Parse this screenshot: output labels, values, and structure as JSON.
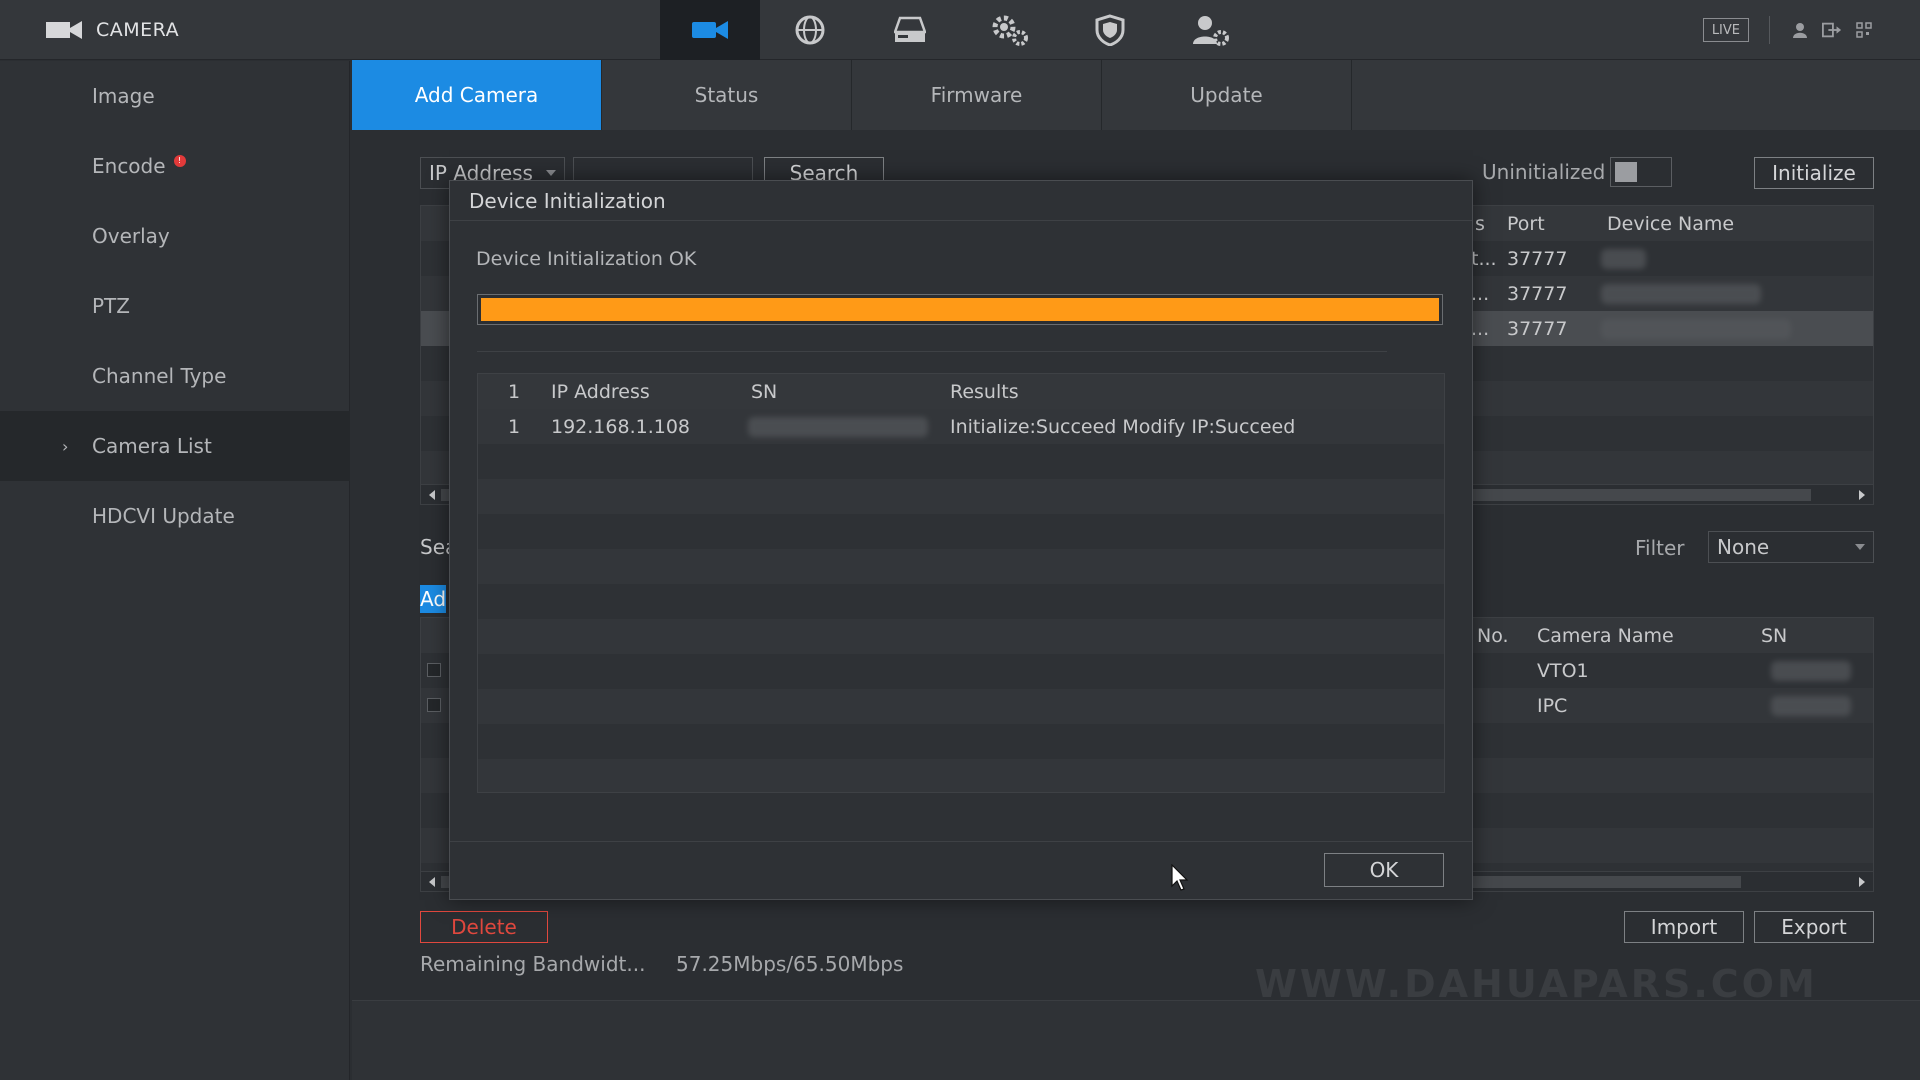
{
  "app": {
    "title": "CAMERA"
  },
  "topbar": {
    "icons": [
      "camera-icon",
      "network-icon",
      "storage-icon",
      "system-settings-icon",
      "security-icon",
      "account-icon"
    ],
    "live_label": "LIVE",
    "right_icons": [
      "user-icon",
      "logout-icon",
      "qr-icon"
    ]
  },
  "sidebar": {
    "items": [
      {
        "label": "Image"
      },
      {
        "label": "Encode",
        "badge": "!"
      },
      {
        "label": "Overlay"
      },
      {
        "label": "PTZ"
      },
      {
        "label": "Channel Type"
      },
      {
        "label": "Camera List",
        "active": true,
        "chevron": "›"
      },
      {
        "label": "HDCVI Update"
      }
    ]
  },
  "tabs": [
    {
      "label": "Add Camera",
      "active": true
    },
    {
      "label": "Status"
    },
    {
      "label": "Firmware"
    },
    {
      "label": "Update"
    }
  ],
  "search_bar": {
    "type_select": "IP Address",
    "search_label": "Search",
    "uninitialized_label": "Uninitialized",
    "initialize_label": "Initialize"
  },
  "device_table": {
    "columns_visible": [
      "s",
      "Port",
      "Device Name"
    ],
    "rows": [
      {
        "col_s": "t...",
        "port": "37777"
      },
      {
        "col_s": "...",
        "port": "37777"
      },
      {
        "col_s": "...",
        "port": "37777",
        "selected": true
      }
    ]
  },
  "added_section": {
    "search_partial": "Sea",
    "add_partial": "Ad",
    "filter_label": "Filter",
    "filter_value": "None",
    "columns_visible": [
      "No.",
      "Camera Name",
      "SN"
    ],
    "rows": [
      {
        "camera_name": "VTO1"
      },
      {
        "camera_name": "IPC"
      }
    ]
  },
  "footer_controls": {
    "delete_label": "Delete",
    "import_label": "Import",
    "export_label": "Export",
    "bandwidth_label": "Remaining Bandwidt...",
    "bandwidth_value": "57.25Mbps/65.50Mbps"
  },
  "watermark": "WWW.DAHUAPARS.COM",
  "modal": {
    "title": "Device Initialization",
    "status": "Device Initialization OK",
    "progress_fraction": 1.0,
    "progress_color": "#ff9a17",
    "columns": [
      "1",
      "IP Address",
      "SN",
      "Results"
    ],
    "rows": [
      {
        "no": "1",
        "ip": "192.168.1.108",
        "results": "Initialize:Succeed Modify IP:Succeed"
      }
    ],
    "ok_label": "OK"
  },
  "colors": {
    "accent": "#1c8be3",
    "danger": "#e0483e",
    "progress": "#ff9a17"
  }
}
